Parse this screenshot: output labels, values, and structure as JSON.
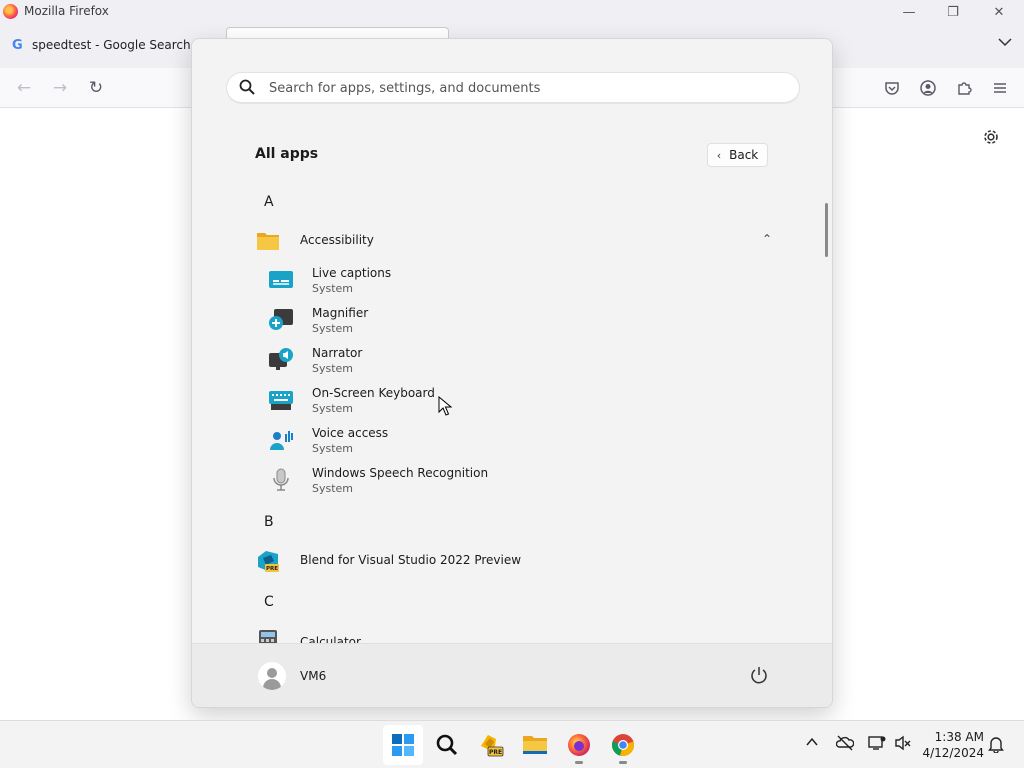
{
  "firefox": {
    "window_title": "Mozilla Firefox",
    "tab_title": "speedtest - Google Search",
    "tab_favicon": "G",
    "controls": {
      "minimize": "—",
      "restore": "❐",
      "close": "✕"
    },
    "nav": {
      "back": "←",
      "forward": "→",
      "reload": "↻"
    },
    "toolbar_icons": [
      "pocket-icon",
      "account-icon",
      "extensions-icon",
      "menu-icon"
    ]
  },
  "start_menu": {
    "search_placeholder": "Search for apps, settings, and documents",
    "section_title": "All apps",
    "back_label": "Back",
    "groups": {
      "a": {
        "letter": "A",
        "folder": {
          "name": "Accessibility",
          "items": [
            {
              "name": "Live captions",
              "publisher": "System"
            },
            {
              "name": "Magnifier",
              "publisher": "System"
            },
            {
              "name": "Narrator",
              "publisher": "System"
            },
            {
              "name": "On-Screen Keyboard",
              "publisher": "System"
            },
            {
              "name": "Voice access",
              "publisher": "System"
            },
            {
              "name": "Windows Speech Recognition",
              "publisher": "System"
            }
          ]
        }
      },
      "b": {
        "letter": "B",
        "apps": [
          {
            "name": "Blend for Visual Studio 2022 Preview",
            "badge": "PRE"
          }
        ]
      },
      "c": {
        "letter": "C",
        "apps": [
          {
            "name": "Calculator"
          }
        ]
      }
    },
    "user": {
      "name": "VM6"
    }
  },
  "taskbar": {
    "clock": {
      "time": "1:38 AM",
      "date": "4/12/2024"
    },
    "pre_badge": "PRE"
  },
  "colors": {
    "accent": "#0078d4",
    "folder": "#f4c23b",
    "start_bg": "#f3f3f3"
  }
}
